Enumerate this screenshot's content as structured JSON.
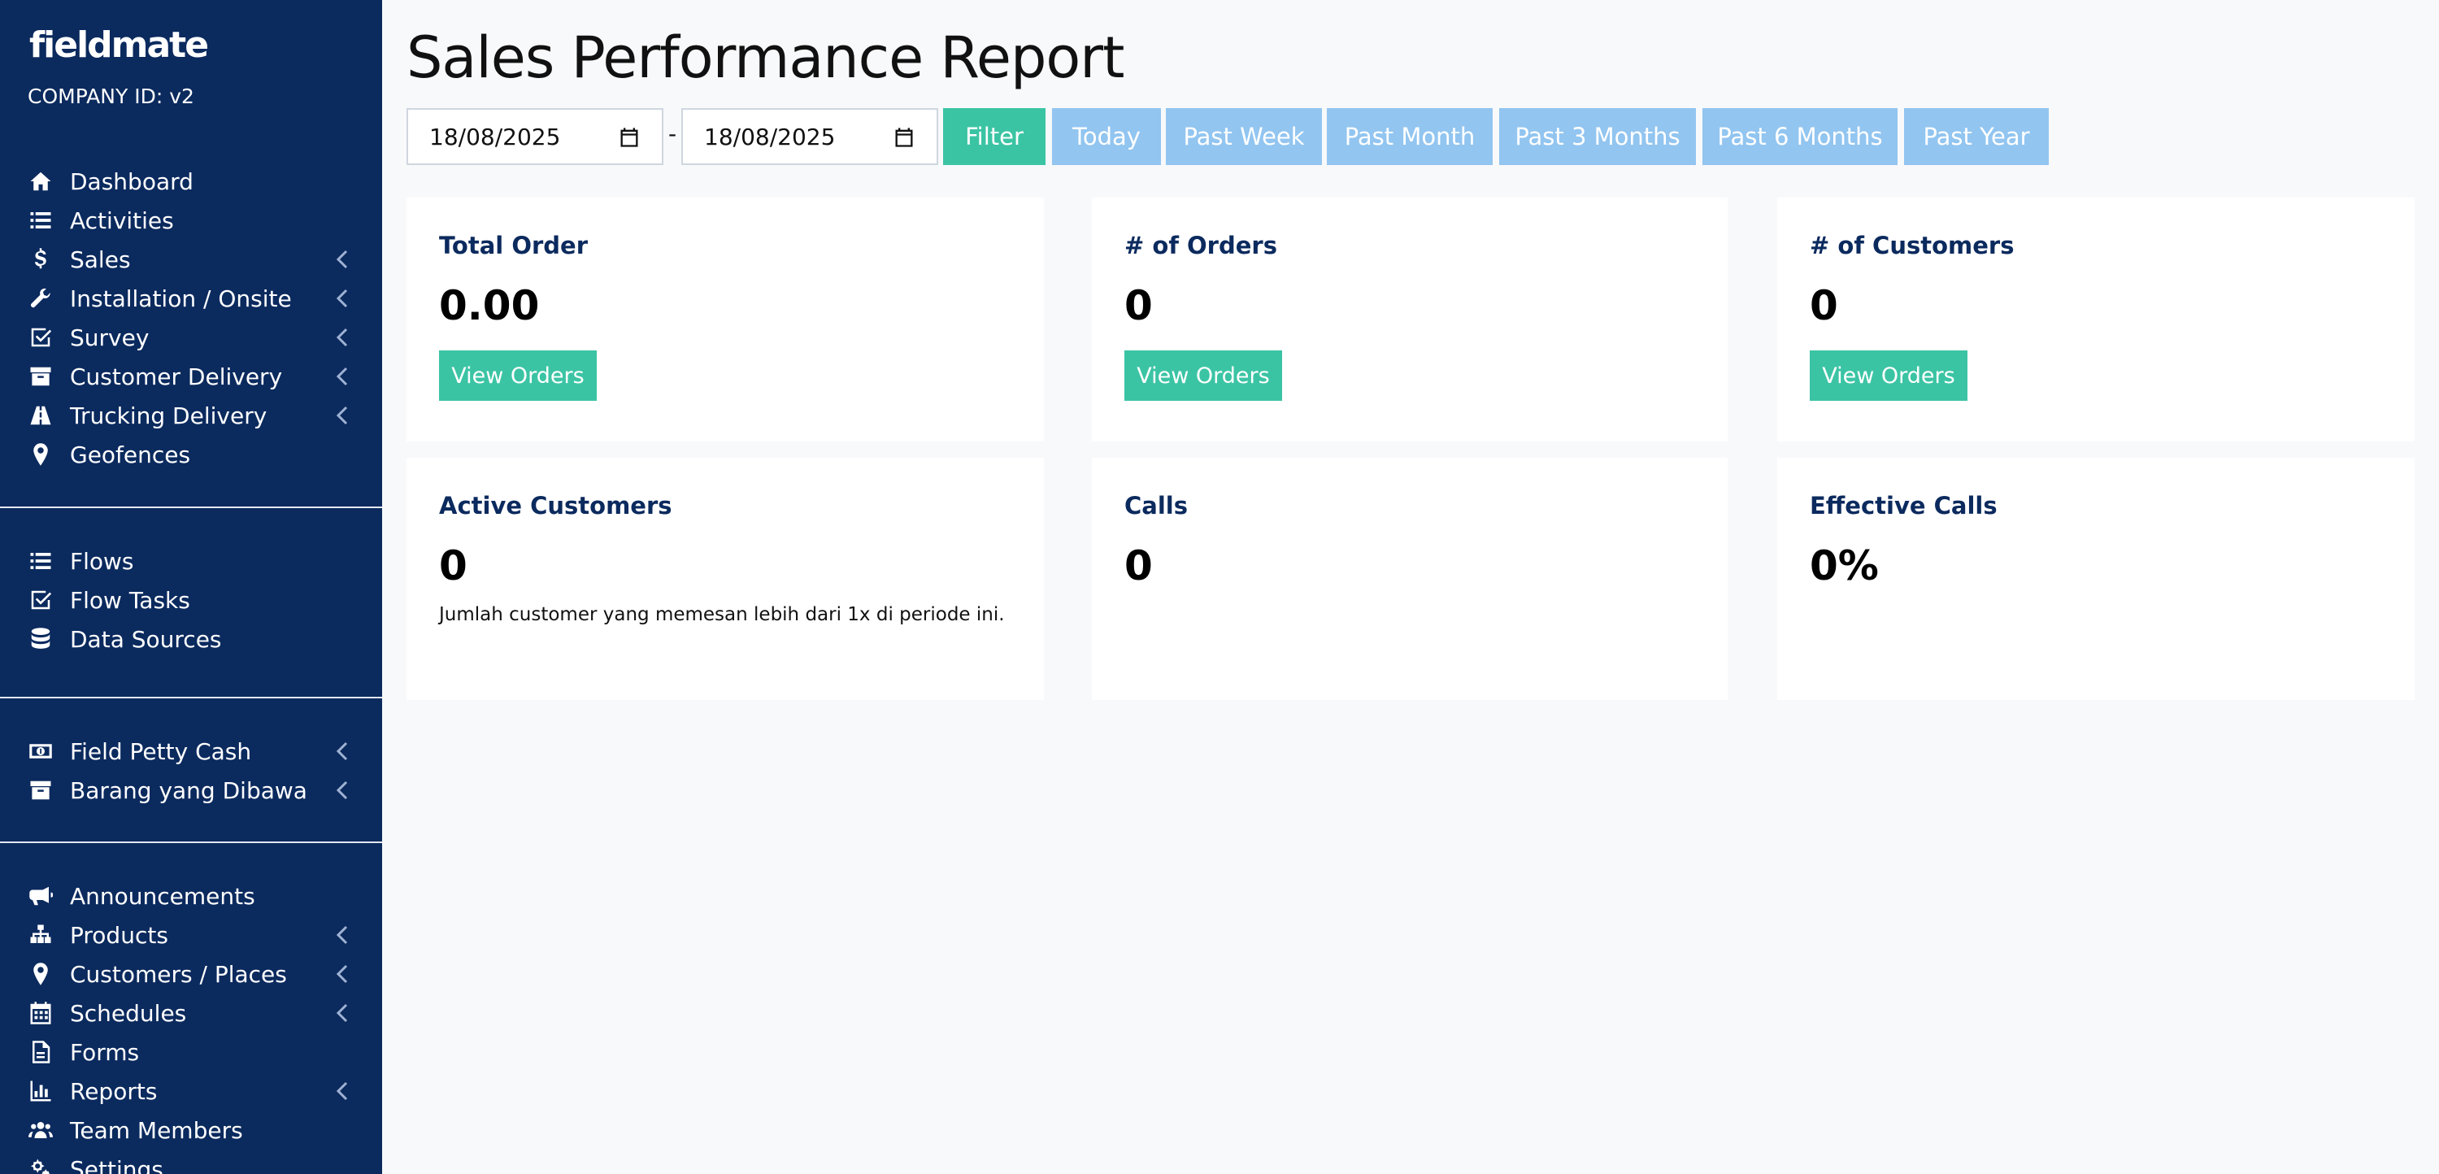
{
  "brand": {
    "logo": "fieldmate",
    "company_id": "COMPANY ID: v2"
  },
  "sidebar": {
    "group1": [
      {
        "label": "Dashboard",
        "icon": "home-icon",
        "chevron": false
      },
      {
        "label": "Activities",
        "icon": "list-icon",
        "chevron": false
      },
      {
        "label": "Sales",
        "icon": "dollar-icon",
        "chevron": true
      },
      {
        "label": "Installation / Onsite",
        "icon": "wrench-icon",
        "chevron": true
      },
      {
        "label": "Survey",
        "icon": "check-square-icon",
        "chevron": true
      },
      {
        "label": "Customer Delivery",
        "icon": "archive-icon",
        "chevron": true
      },
      {
        "label": "Trucking Delivery",
        "icon": "road-icon",
        "chevron": true
      },
      {
        "label": "Geofences",
        "icon": "map-pin-icon",
        "chevron": false
      }
    ],
    "group2": [
      {
        "label": "Flows",
        "icon": "list-icon",
        "chevron": false
      },
      {
        "label": "Flow Tasks",
        "icon": "check-square-icon",
        "chevron": false
      },
      {
        "label": "Data Sources",
        "icon": "database-icon",
        "chevron": false
      }
    ],
    "group3": [
      {
        "label": "Field Petty Cash",
        "icon": "money-bill-icon",
        "chevron": true
      },
      {
        "label": "Barang yang Dibawa",
        "icon": "archive-icon",
        "chevron": true
      }
    ],
    "group4": [
      {
        "label": "Announcements",
        "icon": "bullhorn-icon",
        "chevron": false
      },
      {
        "label": "Products",
        "icon": "sitemap-icon",
        "chevron": true
      },
      {
        "label": "Customers / Places",
        "icon": "map-pin-icon",
        "chevron": true
      },
      {
        "label": "Schedules",
        "icon": "calendar-icon",
        "chevron": true
      },
      {
        "label": "Forms",
        "icon": "file-icon",
        "chevron": false
      },
      {
        "label": "Reports",
        "icon": "bar-chart-icon",
        "chevron": true
      },
      {
        "label": "Team Members",
        "icon": "users-icon",
        "chevron": false
      },
      {
        "label": "Settings",
        "icon": "gears-icon",
        "chevron": false
      }
    ]
  },
  "page": {
    "title": "Sales Performance Report",
    "date_from": "18/08/2025",
    "date_to": "18/08/2025",
    "date_separator": "-",
    "filter_label": "Filter",
    "ranges": [
      "Today",
      "Past Week",
      "Past Month",
      "Past 3 Months",
      "Past 6 Months",
      "Past Year"
    ]
  },
  "cards": [
    {
      "title": "Total Order",
      "value": "0.00",
      "button": "View Orders"
    },
    {
      "title": "# of Orders",
      "value": "0",
      "button": "View Orders"
    },
    {
      "title": "# of Customers",
      "value": "0",
      "button": "View Orders"
    },
    {
      "title": "Active Customers",
      "value": "0",
      "note": "Jumlah customer yang memesan lebih dari 1x di periode ini."
    },
    {
      "title": "Calls",
      "value": "0"
    },
    {
      "title": "Effective Calls",
      "value": "0%"
    }
  ],
  "colors": {
    "sidebar_bg": "#0b2a5e",
    "accent_green": "#3bc4a4",
    "range_blue": "#92c5f0"
  }
}
